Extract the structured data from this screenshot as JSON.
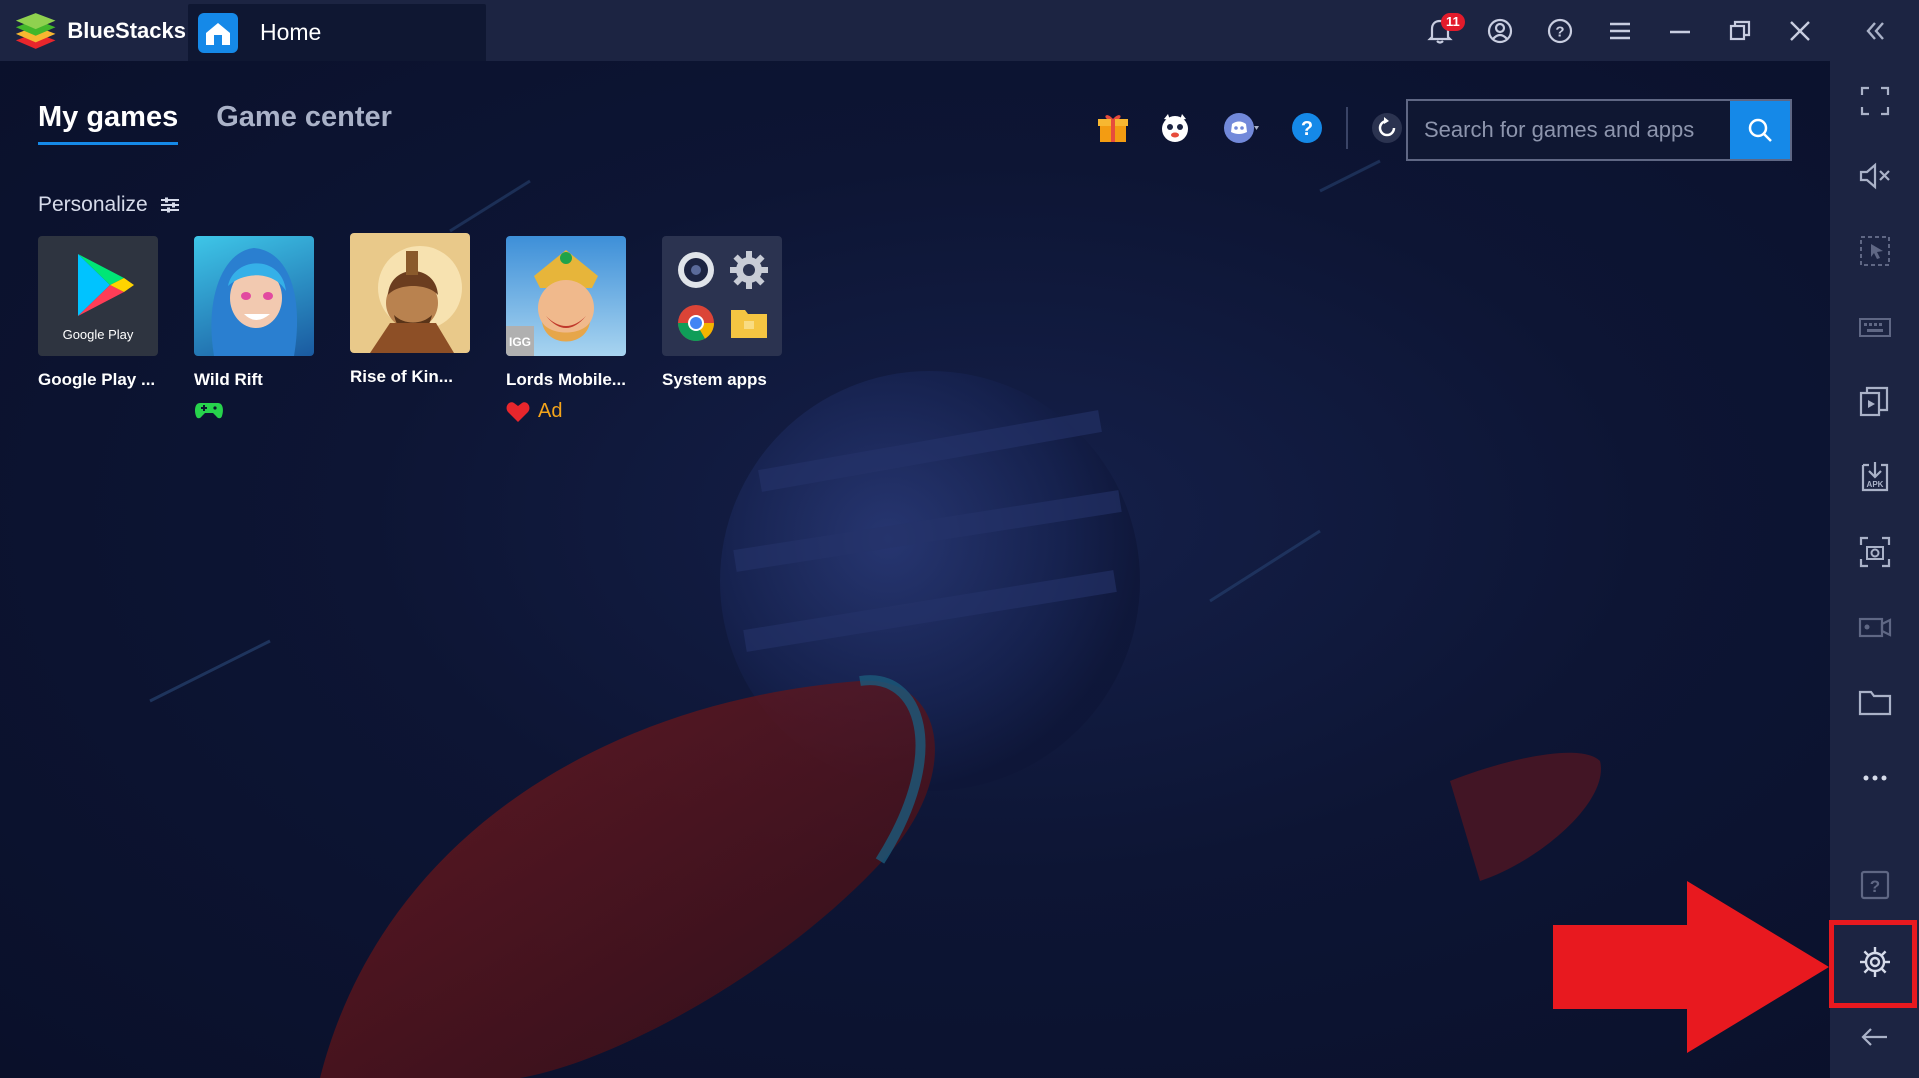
{
  "app": {
    "name": "BlueStacks",
    "tab_label": "Home",
    "notification_count": "11"
  },
  "main": {
    "tabs": [
      {
        "label": "My games",
        "active": true
      },
      {
        "label": "Game center",
        "active": false
      }
    ],
    "search": {
      "placeholder": "Search for games and apps"
    },
    "personalize_label": "Personalize",
    "toolbar_icons": [
      "gift-icon",
      "mascot-icon",
      "discord-icon",
      "help-icon",
      "refresh-icon"
    ],
    "games": [
      {
        "name": "Google Play ...",
        "icon": "google-play"
      },
      {
        "name": "Wild Rift",
        "icon": "wild-rift",
        "badge": "gamepad-icon"
      },
      {
        "name": "Rise of Kin...",
        "icon": "rise-of-kingdoms"
      },
      {
        "name": "Lords Mobile...",
        "icon": "lords-mobile",
        "badge": "heart-icon",
        "ad_label": "Ad"
      },
      {
        "name": "System apps",
        "icon": "system-apps"
      }
    ]
  },
  "sidebar": {
    "items": [
      "collapse-icon",
      "fullscreen-icon",
      "volume-mute-icon",
      "pointer-icon",
      "keyboard-icon",
      "multi-instance-icon",
      "apk-install-icon",
      "screenshot-icon",
      "record-icon",
      "folder-icon",
      "more-icon",
      "help-icon",
      "settings-icon",
      "back-icon"
    ],
    "highlighted": "settings-icon"
  },
  "colors": {
    "accent": "#1589e8",
    "titlebar": "#1c2442",
    "background": "#0d1530",
    "highlight": "#e8191f",
    "ad": "#f4a41a"
  }
}
